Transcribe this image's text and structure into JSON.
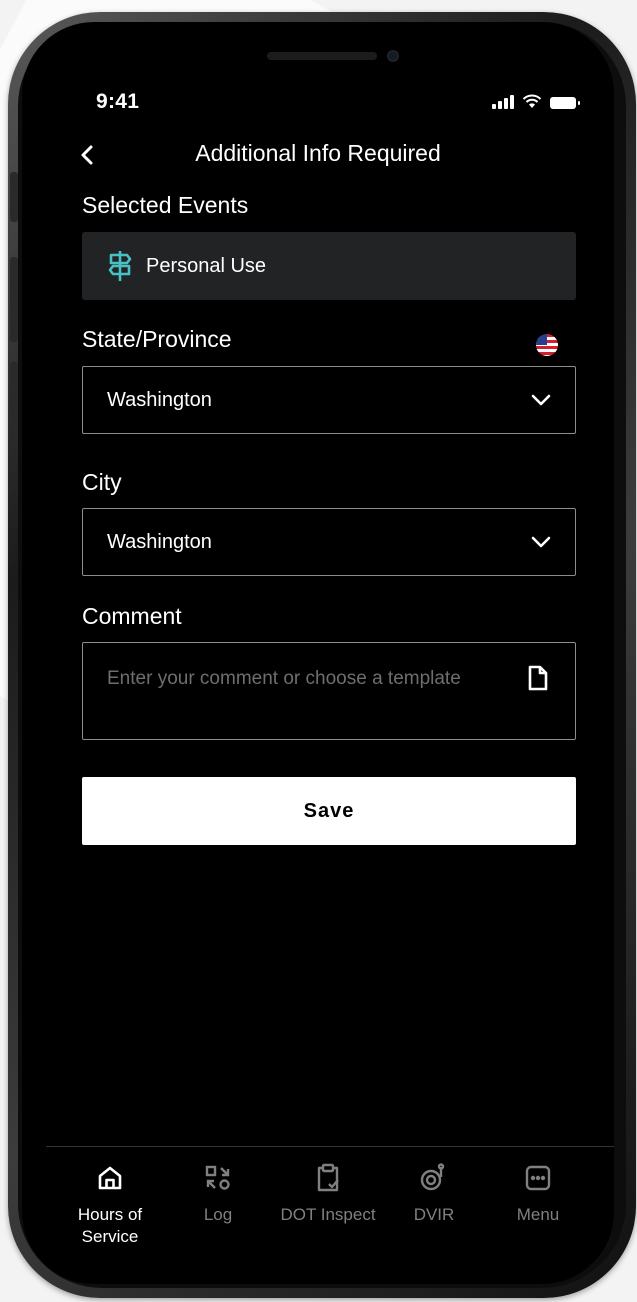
{
  "status_bar": {
    "time": "9:41"
  },
  "header": {
    "title": "Additional Info Required"
  },
  "selected_events": {
    "label": "Selected Events",
    "event": "Personal Use"
  },
  "state": {
    "label": "State/Province",
    "value": "Washington"
  },
  "city": {
    "label": "City",
    "value": "Washington"
  },
  "comment": {
    "label": "Comment",
    "placeholder": "Enter your comment or choose a template"
  },
  "save_label": "Save",
  "tabs": [
    {
      "label": "Hours of Service",
      "icon": "home-icon",
      "active": true
    },
    {
      "label": "Log",
      "icon": "log-icon",
      "active": false
    },
    {
      "label": "DOT Inspect",
      "icon": "clipboard-check-icon",
      "active": false
    },
    {
      "label": "DVIR",
      "icon": "tire-icon",
      "active": false
    },
    {
      "label": "Menu",
      "icon": "menu-dots-icon",
      "active": false
    }
  ],
  "colors": {
    "accent": "#48c1c4",
    "background": "#000000",
    "chip": "#222324"
  }
}
